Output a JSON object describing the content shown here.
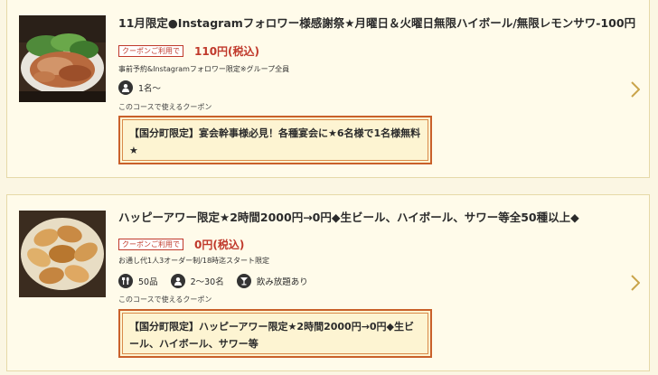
{
  "coupons": [
    {
      "title": "11月限定●Instagramフォロワー様感謝祭★月曜日＆火曜日無限ハイボール/無限レモンサワ-100円",
      "badge": "クーポンご利用で",
      "price": "110円(税込)",
      "conditions": "事前予約&Instagramフォロワー限定※グループ全員",
      "meta": [
        {
          "icon": "person-icon",
          "text": "1名～"
        }
      ],
      "course_note": "このコースで使えるクーポン",
      "promo": "【国分町限定】宴会幹事様必見！各種宴会に★6名様で1名様無料★"
    },
    {
      "title": "ハッピーアワー限定★2時間2000円→0円◆生ビール、ハイボール、サワー等全50種以上◆",
      "badge": "クーポンご利用で",
      "price": "0円(税込)",
      "conditions": "お通し代1人3オーダー制/18時迄スタート限定",
      "meta": [
        {
          "icon": "fork-knife-icon",
          "text": "50品"
        },
        {
          "icon": "person-icon",
          "text": "2～30名"
        },
        {
          "icon": "cocktail-icon",
          "text": "飲み放題あり"
        }
      ],
      "course_note": "このコースで使えるクーポン",
      "promo": "【国分町限定】ハッピーアワー限定★2時間2000円→0円◆生ビール、ハイボール、サワー等"
    }
  ],
  "colors": {
    "accent": "#c0392b",
    "frame": "#c9602a",
    "chevron": "#c9a44a",
    "background": "#fbf6e3"
  }
}
